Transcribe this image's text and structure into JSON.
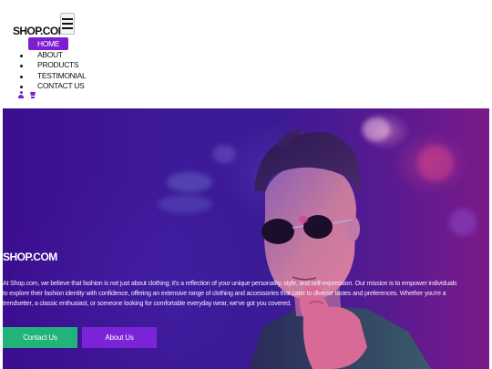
{
  "brand": {
    "logo": "SHOP.COM"
  },
  "nav": {
    "items": [
      {
        "label": "HOME",
        "active": true
      },
      {
        "label": "ABOUT",
        "active": false
      },
      {
        "label": "PRODUCTS",
        "active": false
      },
      {
        "label": "TESTIMONIAL",
        "active": false
      },
      {
        "label": "CONTACT US",
        "active": false
      }
    ]
  },
  "icons": [
    "user-icon",
    "cart-icon",
    "hamburger-menu-icon"
  ],
  "hero": {
    "title": "SHOP.COM",
    "description": "At Shop.com, we believe that fashion is not just about clothing; it's a reflection of your unique personality, style, and self-expression. Our mission is to empower individuals to explore their fashion identity with confidence, offering an extensive range of clothing and accessories that cater to diverse tastes and preferences. Whether you're a trendsetter, a classic enthusiast, or someone looking for comfortable everyday wear, we've got you covered.",
    "buttons": {
      "contact": "Contact Us",
      "about": "About Us"
    }
  },
  "colors": {
    "accent": "#7b1fd1",
    "contact_button": "#22b37a",
    "about_button": "#7b23d6",
    "hero_overlay": "#3b0e8f"
  }
}
